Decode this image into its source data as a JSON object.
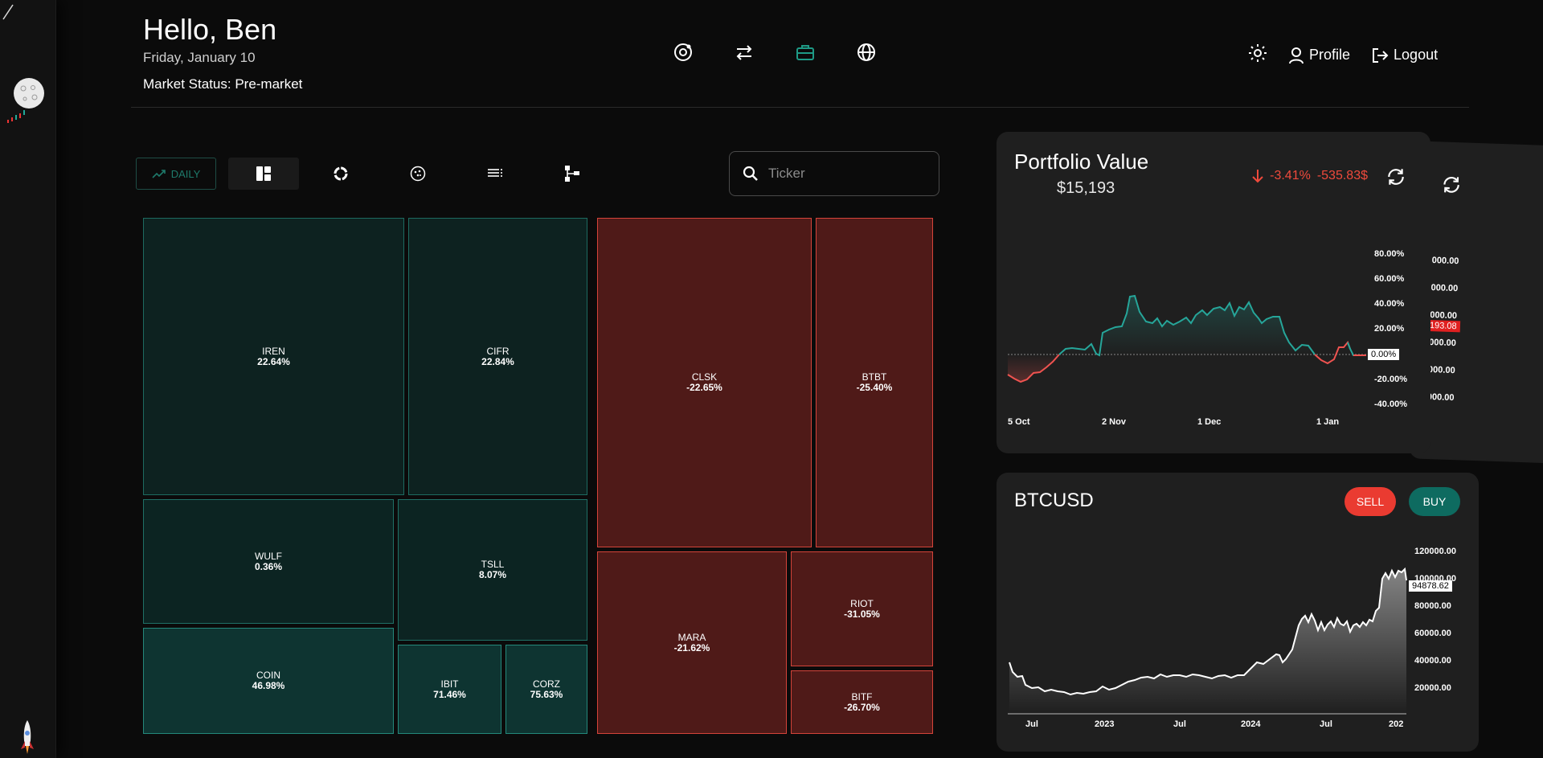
{
  "header": {
    "greeting": "Hello, Ben",
    "date": "Friday, January 10",
    "market_status": "Market Status: Pre-market",
    "profile_label": "Profile",
    "logout_label": "Logout"
  },
  "nav_icons": [
    "orbit-icon",
    "swap-icon",
    "briefcase-icon",
    "globe-icon"
  ],
  "toolbar": {
    "timeframe": "DAILY",
    "view_icons": [
      "treemap-icon",
      "donut-icon",
      "dots-circle-icon",
      "list-icon",
      "hierarchy-icon"
    ],
    "search_placeholder": "Ticker"
  },
  "treemap": [
    {
      "ticker": "IREN",
      "change": "22.64%"
    },
    {
      "ticker": "CIFR",
      "change": "22.84%"
    },
    {
      "ticker": "WULF",
      "change": "0.36%"
    },
    {
      "ticker": "TSLL",
      "change": "8.07%"
    },
    {
      "ticker": "COIN",
      "change": "46.98%"
    },
    {
      "ticker": "IBIT",
      "change": "71.46%"
    },
    {
      "ticker": "CORZ",
      "change": "75.63%"
    },
    {
      "ticker": "CLSK",
      "change": "-22.65%"
    },
    {
      "ticker": "BTBT",
      "change": "-25.40%"
    },
    {
      "ticker": "MARA",
      "change": "-21.62%"
    },
    {
      "ticker": "RIOT",
      "change": "-31.05%"
    },
    {
      "ticker": "BITF",
      "change": "-26.70%"
    }
  ],
  "portfolio": {
    "title": "Portfolio Value",
    "value": "$15,193",
    "change_pct": "-3.41%",
    "change_amt": "-535.83$",
    "y_ticks": [
      "80.00%",
      "60.00%",
      "40.00%",
      "20.00%",
      "0.00%",
      "-20.00%",
      "-40.00%"
    ],
    "current_marker": "0.00%",
    "x_ticks": [
      "5 Oct",
      "2 Nov",
      "1 Dec",
      "1 Jan"
    ],
    "back_card_ticks": [
      "000.00",
      "000.00",
      "000.00",
      "000.00",
      "000.00",
      "000.00"
    ],
    "back_card_marker": "193.08"
  },
  "btc": {
    "title": "BTCUSD",
    "sell_label": "SELL",
    "buy_label": "BUY",
    "y_ticks": [
      "120000.00",
      "100000.00",
      "80000.00",
      "60000.00",
      "40000.00",
      "20000.00"
    ],
    "price_marker": "94878.62",
    "x_ticks": [
      "Jul",
      "2023",
      "Jul",
      "2024",
      "Jul",
      "202"
    ]
  },
  "colors": {
    "positive": "#26a69a",
    "negative": "#ef5350",
    "accent": "#1e7a6b"
  }
}
